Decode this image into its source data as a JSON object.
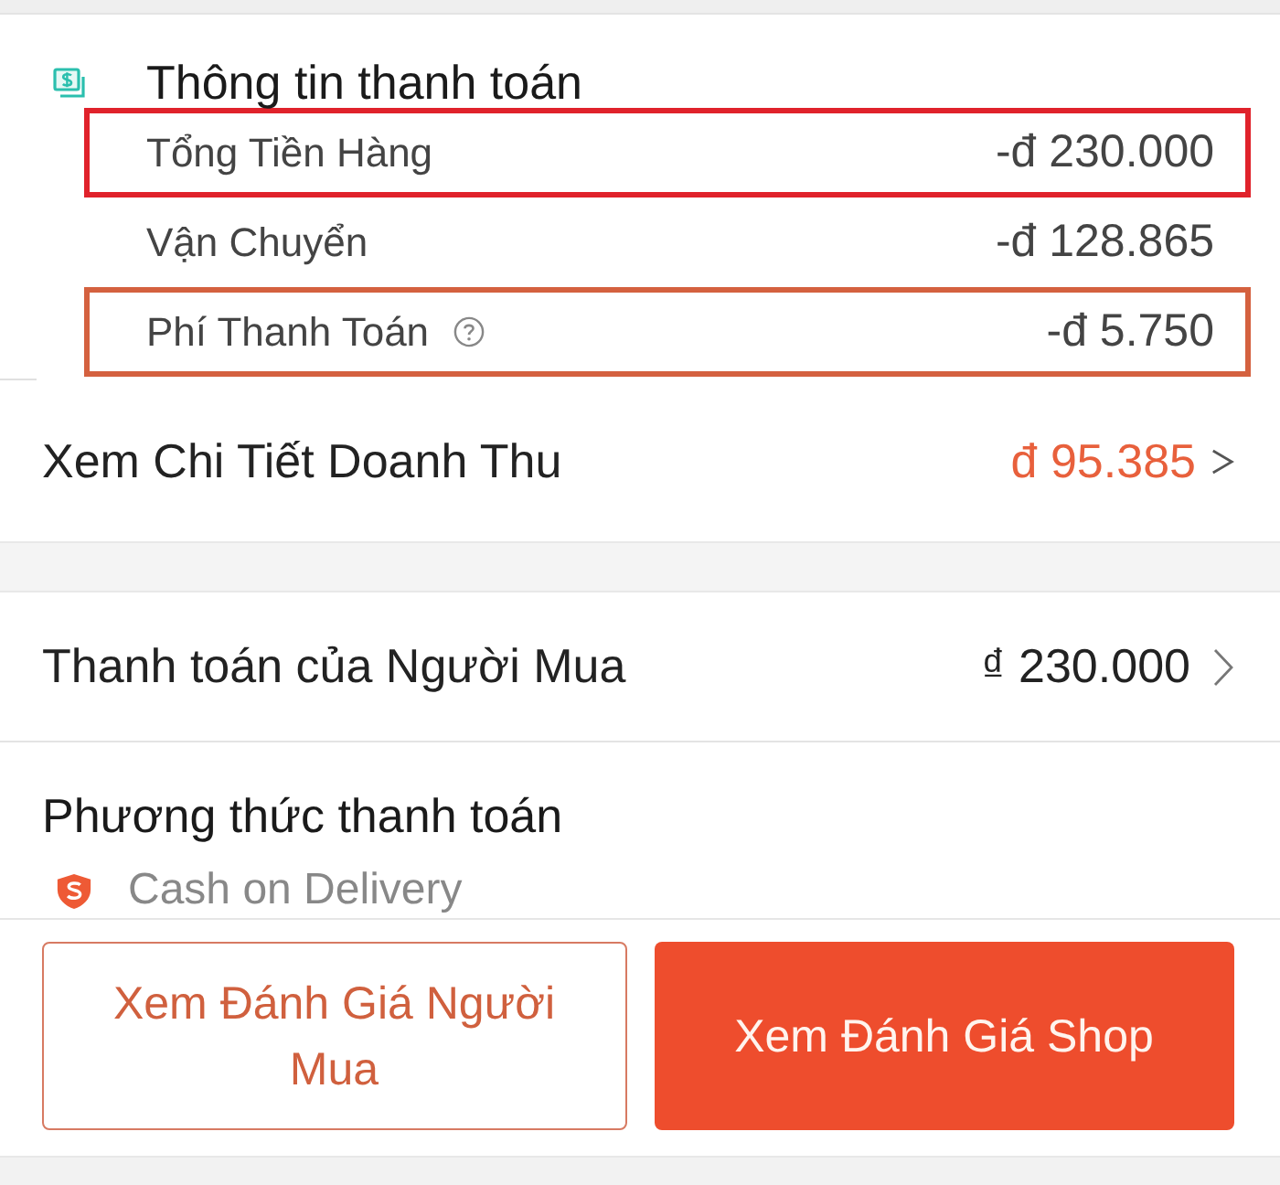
{
  "payment_info": {
    "title": "Thông tin thanh toán",
    "rows": [
      {
        "label": "Tổng Tiền Hàng",
        "value": "-đ 230.000",
        "help_icon": false,
        "highlighted": true,
        "color": "#e0222b"
      },
      {
        "label": "Vận Chuyển",
        "value": "-đ 128.865",
        "help_icon": false,
        "highlighted": false
      },
      {
        "label": "Phí Thanh Toán",
        "value": "-đ 5.750",
        "help_icon": true,
        "highlighted": true,
        "color": "#d4613f"
      }
    ]
  },
  "revenue_link": {
    "label": "Xem Chi Tiết Doanh Thu",
    "value": "đ 95.385"
  },
  "buyer_payment": {
    "label": "Thanh toán của Người Mua",
    "value": "₫ 230.000"
  },
  "payment_method": {
    "title": "Phương thức thanh toán",
    "method": "Cash on Delivery"
  },
  "buttons": [
    {
      "label": "Xem Đánh Giá Người Mua",
      "kind": "outline"
    },
    {
      "label": "Xem Đánh Giá Shop",
      "kind": "filled"
    }
  ]
}
